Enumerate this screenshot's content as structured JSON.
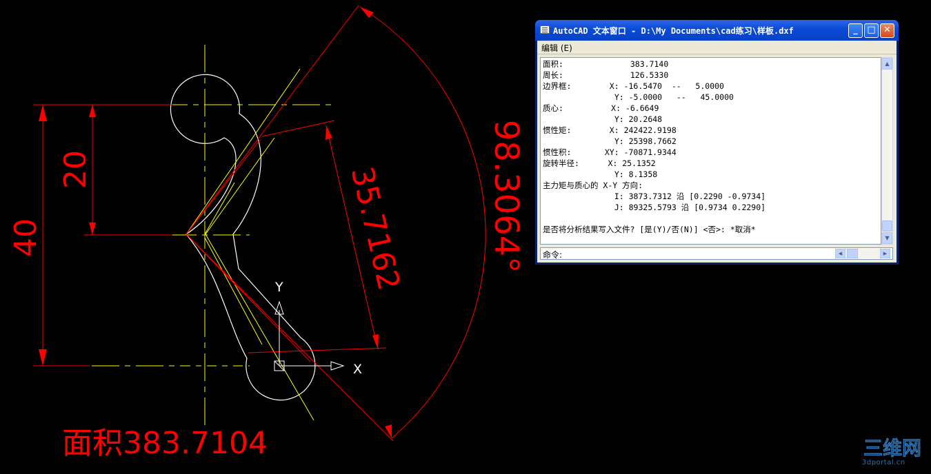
{
  "drawing": {
    "colors": {
      "background": "#000000",
      "dimension": "#ff0000",
      "centerline": "#ffff00",
      "outline": "#ffffff"
    },
    "dimensions": {
      "vertical_40": "40",
      "vertical_20": "20",
      "aligned_35": "35.7162",
      "angular_98": "98.3064°"
    },
    "ucs": {
      "y_label": "Y",
      "x_label": "X"
    },
    "area_label": "面积383.7104"
  },
  "text_window": {
    "title": "AutoCAD 文本窗口 - D:\\My Documents\\cad练习\\样板.dxf",
    "menu_edit": "编辑 (E)",
    "output_lines": [
      "面积:              383.7140",
      "周长:              126.5330",
      "边界框:        X: -16.5470  --   5.0000",
      "               Y: -5.0000   --   45.0000",
      "质心:          X: -6.6649",
      "               Y: 20.2648",
      "惯性矩:        X: 242422.9198",
      "               Y: 25398.7662",
      "惯性积:       XY: -70871.9344",
      "旋转半径:      X: 25.1352",
      "               Y: 8.1358",
      "主力矩与质心的 X-Y 方向:",
      "               I: 3873.7312 沿 [0.2290 -0.9734]",
      "               J: 89325.5793 沿 [0.9734 0.2290]",
      "",
      "是否将分析结果写入文件? [是(Y)/否(N)] <否>: *取消*"
    ],
    "command_label": "命令:"
  },
  "watermark": {
    "logo": "三维网",
    "site": "3dportal.cn"
  }
}
